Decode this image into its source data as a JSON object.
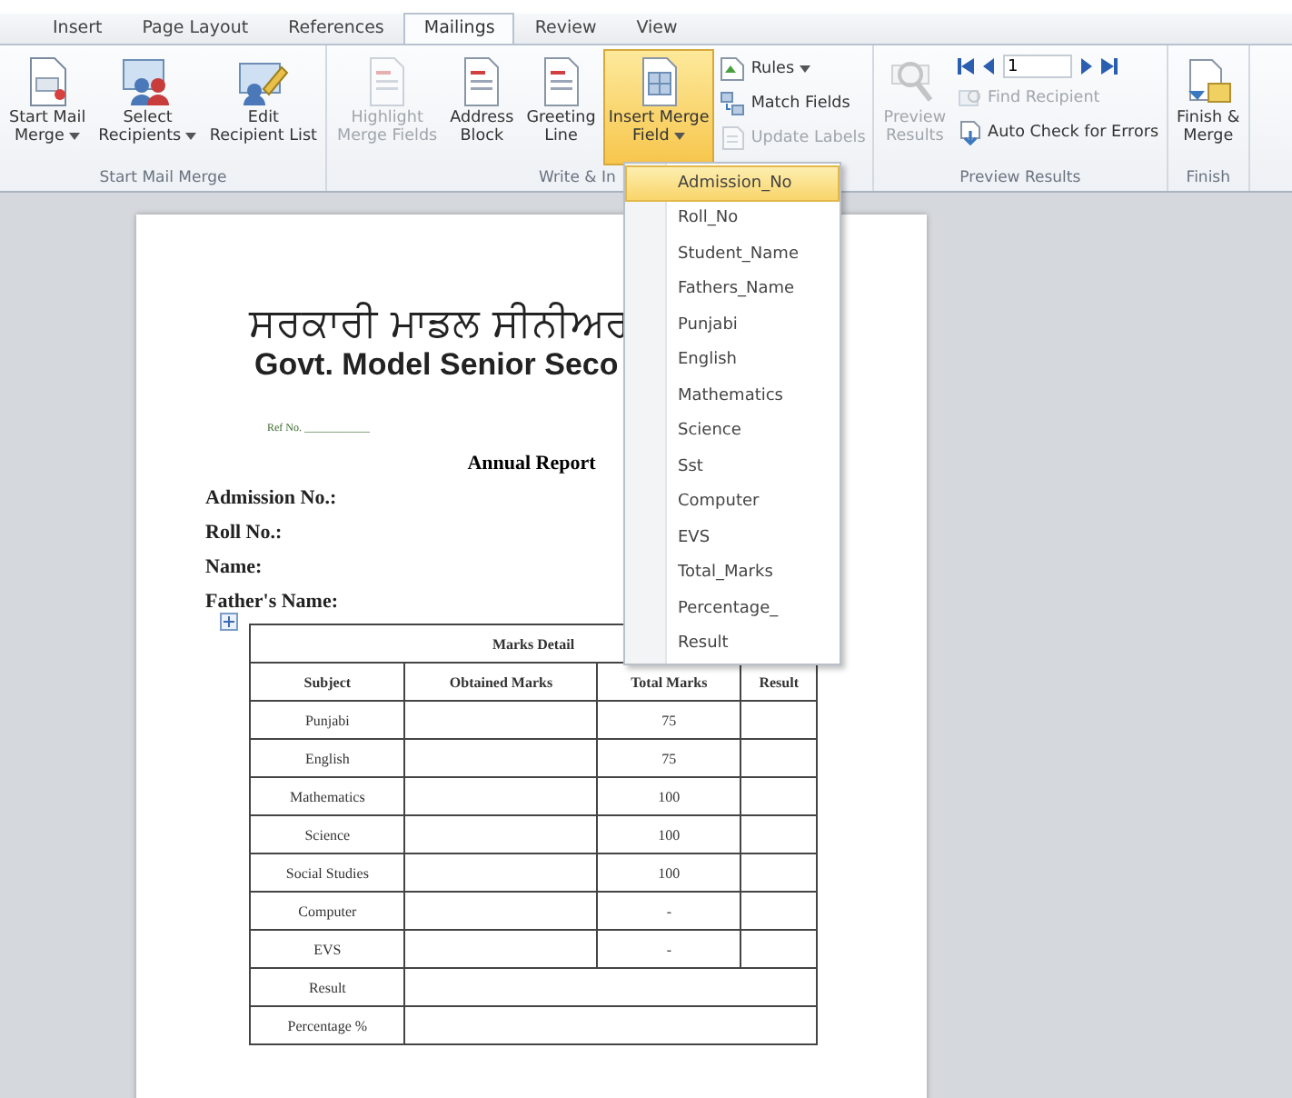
{
  "tabs": [
    {
      "label": "Insert",
      "selected": false
    },
    {
      "label": "Page Layout",
      "selected": false
    },
    {
      "label": "References",
      "selected": false
    },
    {
      "label": "Mailings",
      "selected": true
    },
    {
      "label": "Review",
      "selected": false
    },
    {
      "label": "View",
      "selected": false
    }
  ],
  "ribbon": {
    "groups": [
      {
        "label": "Start Mail Merge",
        "columns": [
          [
            {
              "kind": "large",
              "lines": [
                "Start Mail",
                "Merge"
              ],
              "dropdown": true,
              "disabled": false,
              "selected": false
            }
          ],
          [
            {
              "kind": "large",
              "lines": [
                "Select",
                "Recipients"
              ],
              "dropdown": true,
              "disabled": false,
              "selected": false
            }
          ],
          [
            {
              "kind": "large",
              "lines": [
                "Edit",
                "Recipient List"
              ],
              "dropdown": false,
              "disabled": false,
              "selected": false
            }
          ]
        ]
      },
      {
        "label": "Write & In",
        "columns": [
          [
            {
              "kind": "large",
              "lines": [
                "Highlight",
                "Merge Fields"
              ],
              "dropdown": false,
              "disabled": true,
              "selected": false
            }
          ],
          [
            {
              "kind": "large",
              "lines": [
                "Address",
                "Block"
              ],
              "dropdown": false,
              "disabled": false,
              "selected": false
            }
          ],
          [
            {
              "kind": "large",
              "lines": [
                "Greeting",
                "Line"
              ],
              "dropdown": false,
              "disabled": false,
              "selected": false
            }
          ],
          [
            {
              "kind": "large",
              "lines": [
                "Insert Merge",
                "Field"
              ],
              "dropdown": true,
              "disabled": false,
              "selected": true
            }
          ],
          [
            {
              "kind": "small",
              "label": "Rules",
              "dropdown": true,
              "disabled": false
            },
            {
              "kind": "small",
              "label": "Match Fields",
              "dropdown": false,
              "disabled": false
            },
            {
              "kind": "small",
              "label": "Update Labels",
              "dropdown": false,
              "disabled": true
            }
          ]
        ]
      },
      {
        "label": "Preview Results",
        "columns": [
          [
            {
              "kind": "large",
              "lines": [
                "Preview",
                "Results"
              ],
              "dropdown": false,
              "disabled": true,
              "selected": false
            }
          ],
          [
            {
              "kind": "navigator",
              "record": "1"
            },
            {
              "kind": "small",
              "label": "Find Recipient",
              "dropdown": false,
              "disabled": true
            },
            {
              "kind": "small",
              "label": "Auto Check for Errors",
              "dropdown": false,
              "disabled": false
            }
          ]
        ]
      },
      {
        "label": "Finish",
        "columns": [
          [
            {
              "kind": "large",
              "lines": [
                "Finish &",
                "Merge"
              ],
              "dropdown": false,
              "disabled": false,
              "selected": false
            }
          ]
        ]
      }
    ]
  },
  "document": {
    "heading_punjabi": "ਸਰਕਾਰੀ ਮਾਡਲ ਸੀਨੀਅਰ",
    "heading_english": "Govt. Model Senior Seco",
    "ref": "Ref No. ____________",
    "title": "Annual Report",
    "fields": [
      "Admission No.:",
      "Roll No.:",
      "Name:",
      "Father's Name:"
    ],
    "table": {
      "title": "Marks Detail",
      "columns": [
        "Subject",
        "Obtained Marks",
        "Total Marks",
        "Result"
      ],
      "rows": [
        {
          "subject": "Punjabi",
          "total": "75"
        },
        {
          "subject": "English",
          "total": "75"
        },
        {
          "subject": "Mathematics",
          "total": "100"
        },
        {
          "subject": "Science",
          "total": "100"
        },
        {
          "subject": "Social Studies",
          "total": "100"
        },
        {
          "subject": "Computer",
          "total": "-"
        },
        {
          "subject": "EVS",
          "total": "-"
        }
      ],
      "summary_rows": [
        "Result",
        "Percentage %"
      ]
    }
  },
  "merge_field_menu": {
    "items": [
      {
        "label": "Admission_No",
        "selected": true
      },
      {
        "label": "Roll_No",
        "selected": false
      },
      {
        "label": "Student_Name",
        "selected": false
      },
      {
        "label": "Fathers_Name",
        "selected": false
      },
      {
        "label": "Punjabi",
        "selected": false
      },
      {
        "label": "English",
        "selected": false
      },
      {
        "label": "Mathematics",
        "selected": false
      },
      {
        "label": "Science",
        "selected": false
      },
      {
        "label": "Sst",
        "selected": false
      },
      {
        "label": "Computer",
        "selected": false
      },
      {
        "label": "EVS",
        "selected": false
      },
      {
        "label": "Total_Marks",
        "selected": false
      },
      {
        "label": "Percentage_",
        "selected": false
      },
      {
        "label": "Result",
        "selected": false
      }
    ]
  }
}
